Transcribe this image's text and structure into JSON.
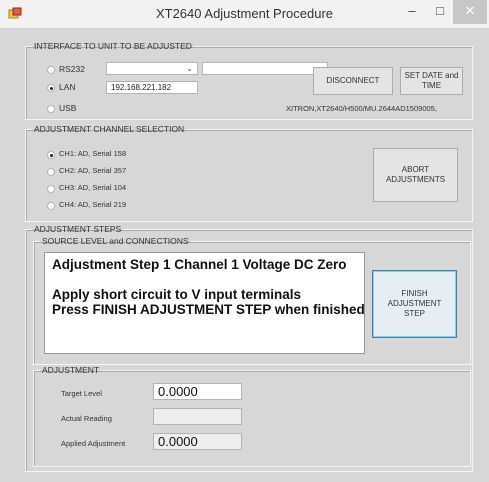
{
  "window": {
    "title": "XT2640 Adjustment Procedure",
    "minimize_glyph": "–",
    "maximize_glyph": "□",
    "close_glyph": "✕"
  },
  "interface": {
    "legend": "INTERFACE TO UNIT TO BE ADJUSTED",
    "options": [
      {
        "label": "RS232",
        "checked": false
      },
      {
        "label": "LAN",
        "checked": true
      },
      {
        "label": "USB",
        "checked": false
      }
    ],
    "ip_address": "192.168.221.182",
    "disconnect_label": "DISCONNECT",
    "set_date_label_line1": "SET DATE and",
    "set_date_label_line2": "TIME",
    "device_id": "XITRON,XT2640/H500/MU.2644AD1509005,"
  },
  "channel_selection": {
    "legend": "ADJUSTMENT CHANNEL SELECTION",
    "channels": [
      {
        "label": "CH1: AD, Serial 158",
        "checked": true
      },
      {
        "label": "CH2: AD, Serial 357",
        "checked": false
      },
      {
        "label": "CH3: AD, Serial 104",
        "checked": false
      },
      {
        "label": "CH4: AD, Serial 219",
        "checked": false
      }
    ],
    "abort_label_line1": "ABORT",
    "abort_label_line2": "ADJUSTMENTS"
  },
  "steps": {
    "legend": "ADJUSTMENT STEPS",
    "source_legend": "SOURCE LEVEL and CONNECTIONS",
    "message_line1": "Adjustment Step 1 Channel 1 Voltage DC Zero",
    "message_line2": "Apply short circuit to V input terminals",
    "message_line3": "Press FINISH ADJUSTMENT STEP when finished",
    "finish_label_line1": "FINISH",
    "finish_label_line2": "ADJUSTMENT",
    "finish_label_line3": "STEP"
  },
  "adjustment": {
    "legend": "ADJUSTMENT",
    "target_label": "Target Level",
    "target_value": "0.0000",
    "actual_label": "Actual Reading",
    "actual_value": "",
    "applied_label": "Applied Adjustment",
    "applied_value": "0.0000"
  },
  "colors": {
    "window_bg": "#d7d7d7",
    "titlebar_bg": "#f2f2f2",
    "focus_border": "#3c7fb1"
  }
}
